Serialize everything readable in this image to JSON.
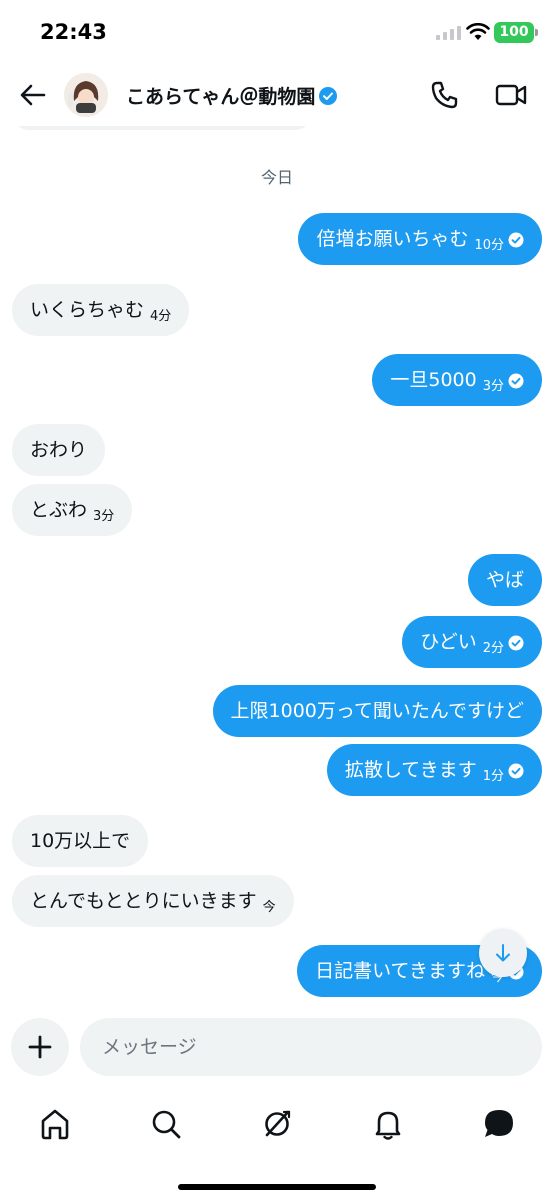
{
  "status_bar": {
    "time": "22:43",
    "battery": "100"
  },
  "header": {
    "name": "こあらてゃん＠動物園",
    "verified": true
  },
  "chat": {
    "date_label": "今日",
    "messages": [
      {
        "dir": "out",
        "text": "倍増お願いちゃむ",
        "time": "10分",
        "read": true
      },
      {
        "dir": "in",
        "text": "いくらちゃむ",
        "time": "4分"
      },
      {
        "dir": "out",
        "text": "一旦5000",
        "time": "3分",
        "read": true
      },
      {
        "dir": "in",
        "text": "おわり"
      },
      {
        "dir": "in",
        "text": "とぶわ",
        "time": "3分"
      },
      {
        "dir": "out",
        "text": "やば"
      },
      {
        "dir": "out",
        "text": "ひどい",
        "time": "2分",
        "read": true
      },
      {
        "dir": "out",
        "text": "上限1000万って聞いたんですけど"
      },
      {
        "dir": "out",
        "text": "拡散してきます",
        "time": "1分",
        "read": true
      },
      {
        "dir": "in",
        "text": "10万以上で"
      },
      {
        "dir": "in",
        "text": "とんでもととりにいきます",
        "time": "今"
      },
      {
        "dir": "out",
        "text": "日記書いてきますね",
        "time": "今",
        "read": true
      }
    ]
  },
  "composer": {
    "placeholder": "メッセージ"
  },
  "colors": {
    "accent": "#1d9bf0",
    "incoming_bubble": "#eff3f4",
    "battery": "#34c759"
  },
  "tabs": [
    "home-icon",
    "search-icon",
    "grok-icon",
    "notifications-icon",
    "messages-icon"
  ]
}
